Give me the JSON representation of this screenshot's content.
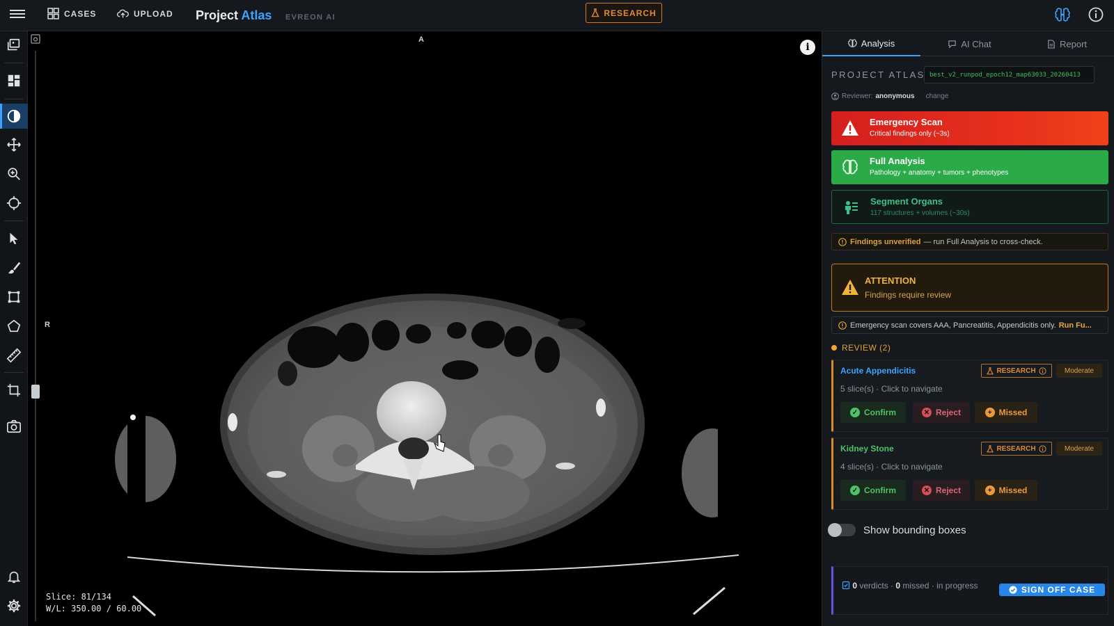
{
  "topbar": {
    "nav_cases": "CASES",
    "nav_upload": "UPLOAD",
    "brand_main": "Project ",
    "brand_accent": "Atlas",
    "brand_sub": "EVREON AI",
    "research_label": "RESEARCH"
  },
  "viewer": {
    "orient_top": "A",
    "orient_left": "R",
    "info_glyph": "i",
    "slice": "Slice: 81/134",
    "window_level": "W/L: 350.00 / 60.00",
    "slice_position": 0.6
  },
  "panel": {
    "tabs": [
      {
        "label": "Analysis"
      },
      {
        "label": "AI Chat"
      },
      {
        "label": "Report"
      }
    ],
    "project_label": "PROJECT ATLAS",
    "model_id": "best_v2_runpod_epoch12_map63033_20260413",
    "reviewer_label": "Reviewer:",
    "reviewer_name": "anonymous",
    "reviewer_change": "change",
    "actions": {
      "emergency": {
        "title": "Emergency Scan",
        "sub": "Critical findings only (~3s)"
      },
      "full": {
        "title": "Full Analysis",
        "sub": "Pathology + anatomy + tumors + phenotypes"
      },
      "segment": {
        "title": "Segment Organs",
        "sub": "117 structures + volumes (~30s)"
      }
    },
    "unverified_bold": "Findings unverified",
    "unverified_rest": "— run Full Analysis to cross-check.",
    "attention_title": "ATTENTION",
    "attention_sub": "Findings require review",
    "scope_text": "Emergency scan covers AAA, Pancreatitis, Appendicitis only.",
    "scope_link": "Run Fu...",
    "review_heading": "REVIEW (2)",
    "findings": [
      {
        "name": "Acute Appendicitis",
        "name_color": "#3ea3ff",
        "meta": "5 slice(s) · Click to navigate",
        "research": "RESEARCH",
        "severity": "Moderate",
        "confirm": "Confirm",
        "reject": "Reject",
        "missed": "Missed"
      },
      {
        "name": "Kidney Stone",
        "name_color": "#4ec267",
        "meta": "4 slice(s) · Click to navigate",
        "research": "RESEARCH",
        "severity": "Moderate",
        "confirm": "Confirm",
        "reject": "Reject",
        "missed": "Missed"
      }
    ],
    "bbox_toggle_label": "Show bounding boxes",
    "bbox_toggle_on": false,
    "verdict_count": "0",
    "verdicts_word": "verdicts",
    "missed_count": "0",
    "missed_word": "missed",
    "status_text": "in progress",
    "signoff_label": "SIGN OFF CASE"
  },
  "colors": {
    "accent": "#3ea3ff",
    "research": "#e38a34",
    "emergency": "#d41f1f",
    "full_analysis": "#2bab47",
    "segment": "#3ec08a"
  },
  "icons": {
    "toolbar": [
      "layers-icon",
      "layout-icon",
      "contrast-icon",
      "pan-icon",
      "zoom-icon",
      "crosshair-icon",
      "pointer-icon",
      "brush-icon",
      "bbox-icon",
      "polygon-icon",
      "ruler-icon",
      "crop-icon",
      "screenshot-icon",
      "bell-icon",
      "gear-icon"
    ]
  }
}
